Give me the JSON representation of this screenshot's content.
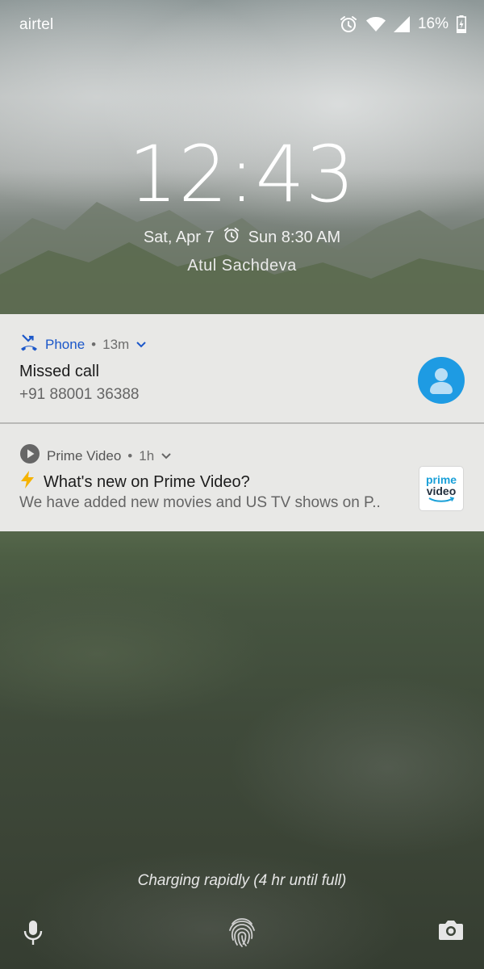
{
  "status_bar": {
    "carrier": "airtel",
    "battery_percent": "16%",
    "icons": [
      "alarm-icon",
      "wifi-icon",
      "signal-icon",
      "battery-charging-icon"
    ]
  },
  "lockscreen": {
    "time": "12:43",
    "date": "Sat, Apr 7",
    "alarm": "Sun 8:30 AM",
    "owner": "Atul Sachdeva"
  },
  "notifications": [
    {
      "app": "Phone",
      "separator": "•",
      "time_ago": "13m",
      "title": "Missed call",
      "text": "+91 88001 36388",
      "icon": "missed-call-icon",
      "accent": "#1b57c9"
    },
    {
      "app": "Prime Video",
      "separator": "•",
      "time_ago": "1h",
      "title_emoji": "⚡",
      "title": "What's new on Prime Video?",
      "text": "We have added new movies and US TV shows on P..",
      "icon": "play-icon",
      "logo_line1": "prime",
      "logo_line2": "video"
    }
  ],
  "footer": {
    "charging_text": "Charging rapidly (4 hr until full)",
    "icons": [
      "mic-icon",
      "fingerprint-icon",
      "camera-icon"
    ]
  },
  "colors": {
    "notification_bg": "#e8e8e6",
    "avatar_bg": "#1e9be3",
    "phone_accent": "#1b57c9"
  }
}
